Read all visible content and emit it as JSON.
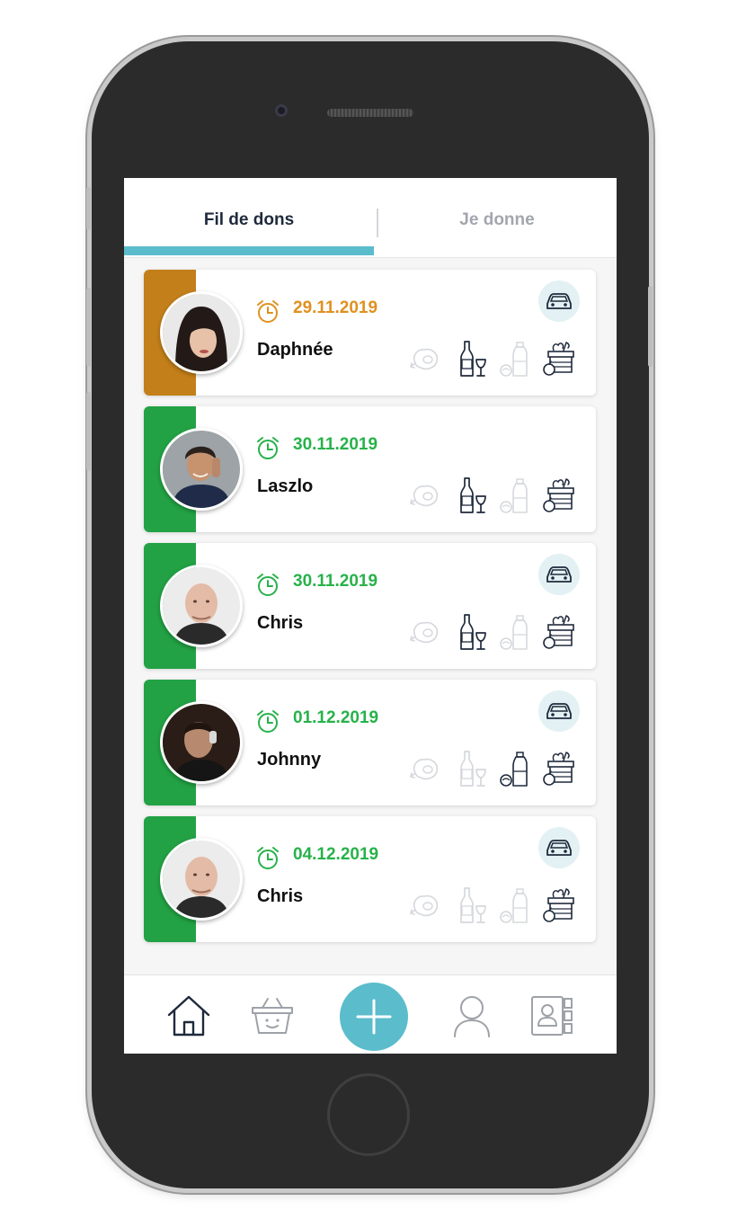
{
  "tabs": {
    "active_label": "Fil de dons",
    "inactive_label": "Je donne",
    "accent_color": "#5bbccc"
  },
  "colors": {
    "orange": "#e0901f",
    "orange_band": "#c37f1a",
    "green": "#27b24a",
    "green_band": "#22a244"
  },
  "donations": [
    {
      "date": "29.11.2019",
      "name": "Daphnée",
      "status_color": "orange",
      "transport": "car-icon",
      "categories": {
        "meat": false,
        "wine": true,
        "grocery": false,
        "produce": true
      }
    },
    {
      "date": "30.11.2019",
      "name": "Laszlo",
      "status_color": "green",
      "transport": null,
      "categories": {
        "meat": false,
        "wine": true,
        "grocery": false,
        "produce": true
      }
    },
    {
      "date": "30.11.2019",
      "name": "Chris",
      "status_color": "green",
      "transport": "car-icon",
      "categories": {
        "meat": false,
        "wine": true,
        "grocery": false,
        "produce": true
      }
    },
    {
      "date": "01.12.2019",
      "name": "Johnny",
      "status_color": "green",
      "transport": "car-icon",
      "categories": {
        "meat": false,
        "wine": false,
        "grocery": true,
        "produce": true
      }
    },
    {
      "date": "04.12.2019",
      "name": "Chris",
      "status_color": "green",
      "transport": "car-icon",
      "categories": {
        "meat": false,
        "wine": false,
        "grocery": false,
        "produce": true
      }
    }
  ],
  "bottom_nav": {
    "items": [
      "home-icon",
      "basket-icon",
      "add-icon",
      "user-icon",
      "contacts-icon"
    ],
    "active": "home-icon"
  }
}
